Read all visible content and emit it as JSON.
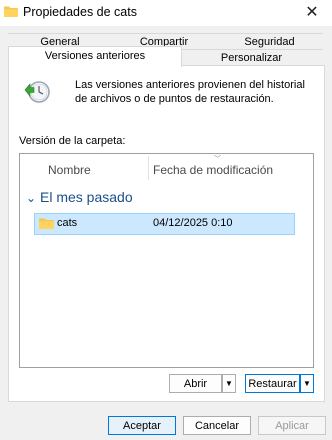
{
  "window": {
    "title": "Propiedades de cats",
    "close_glyph": "✕"
  },
  "tabs": {
    "row1": [
      "General",
      "Compartir",
      "Seguridad"
    ],
    "row2": [
      "Versiones anteriores",
      "Personalizar"
    ],
    "active": "Versiones anteriores"
  },
  "panel": {
    "description": "Las versiones anteriores provienen del historial de archivos o de puntos de restauración.",
    "section_label": "Versión de la carpeta:",
    "columns": [
      "Nombre",
      "Fecha de modificación"
    ],
    "sort_glyph": "﹀",
    "group": {
      "chevron": "⌄",
      "label": "El mes pasado"
    },
    "rows": [
      {
        "name": "cats",
        "date": "04/12/2025 0:10",
        "selected": true
      }
    ],
    "buttons": {
      "open": "Abrir",
      "restore": "Restaurar",
      "dropdown_glyph": "▼"
    }
  },
  "footer": {
    "ok": "Aceptar",
    "cancel": "Cancelar",
    "apply": "Aplicar"
  },
  "icons": {
    "title": "folder-icon",
    "restore": "restore-clock-icon",
    "row": "folder-icon"
  },
  "colors": {
    "accent": "#0078d7",
    "selection_bg": "#cce8ff",
    "selection_border": "#99d1ff",
    "group_text": "#1b4f8a"
  }
}
